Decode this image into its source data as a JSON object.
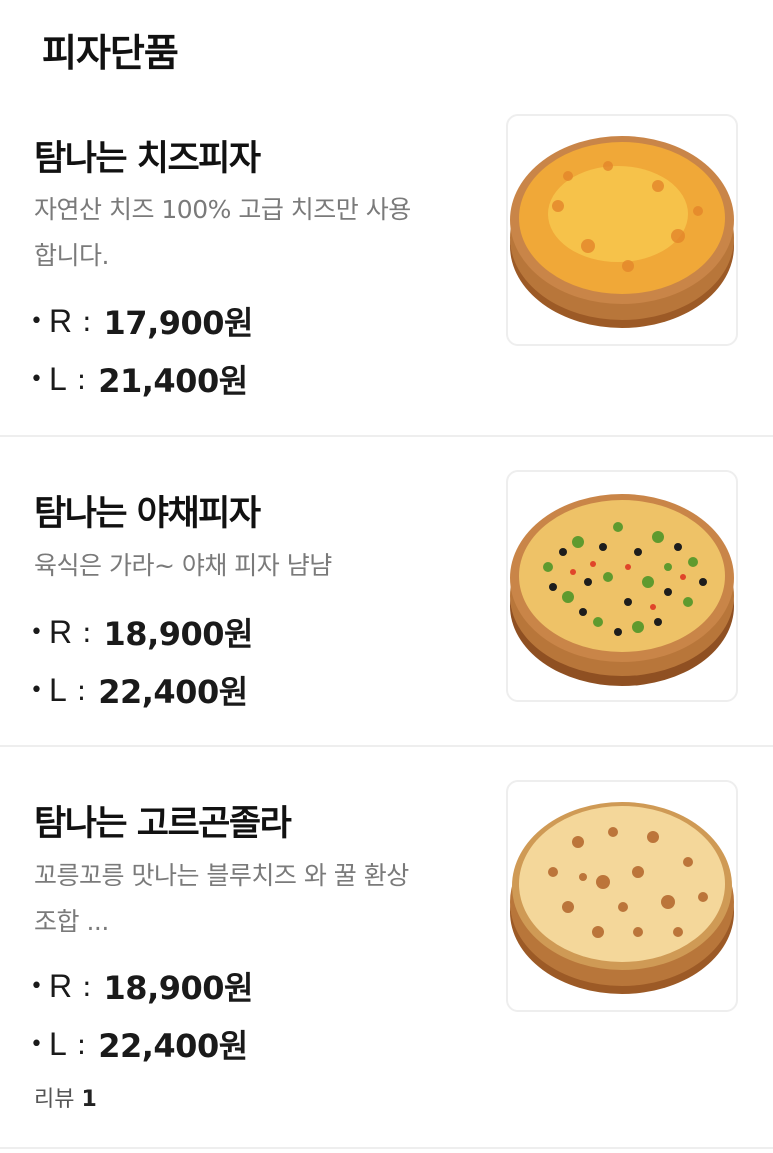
{
  "section_title": "피자단품",
  "items": [
    {
      "name": "탐나는 치즈피자",
      "description": "자연산 치즈 100%  고급 치즈만 사용합니다.",
      "prices": [
        {
          "bullet": "•",
          "size": "R",
          "colon": ":",
          "amount": "17,900원"
        },
        {
          "bullet": "•",
          "size": "L",
          "colon": ":",
          "amount": "21,400원"
        }
      ],
      "image_icon": "cheese-pizza-image"
    },
    {
      "name": "탐나는 야채피자",
      "description": "육식은 가라~ 야채 피자 냠냠",
      "prices": [
        {
          "bullet": "•",
          "size": "R",
          "colon": ":",
          "amount": "18,900원"
        },
        {
          "bullet": "•",
          "size": "L",
          "colon": ":",
          "amount": "22,400원"
        }
      ],
      "image_icon": "vegetable-pizza-image"
    },
    {
      "name": "탐나는 고르곤졸라",
      "description": "꼬릉꼬릉 맛나는 블루치즈 와 꿀 환상조합 ...",
      "prices": [
        {
          "bullet": "•",
          "size": "R",
          "colon": ":",
          "amount": "18,900원"
        },
        {
          "bullet": "•",
          "size": "L",
          "colon": ":",
          "amount": "22,400원"
        }
      ],
      "review_label": "리뷰",
      "review_count": "1",
      "image_icon": "gorgonzola-pizza-image"
    }
  ],
  "colors": {
    "divider": "#eeeeee",
    "description": "#7a7a7a",
    "crust": "#c77a3e",
    "board": "#a8662f",
    "cheese": "#f2b23a"
  }
}
